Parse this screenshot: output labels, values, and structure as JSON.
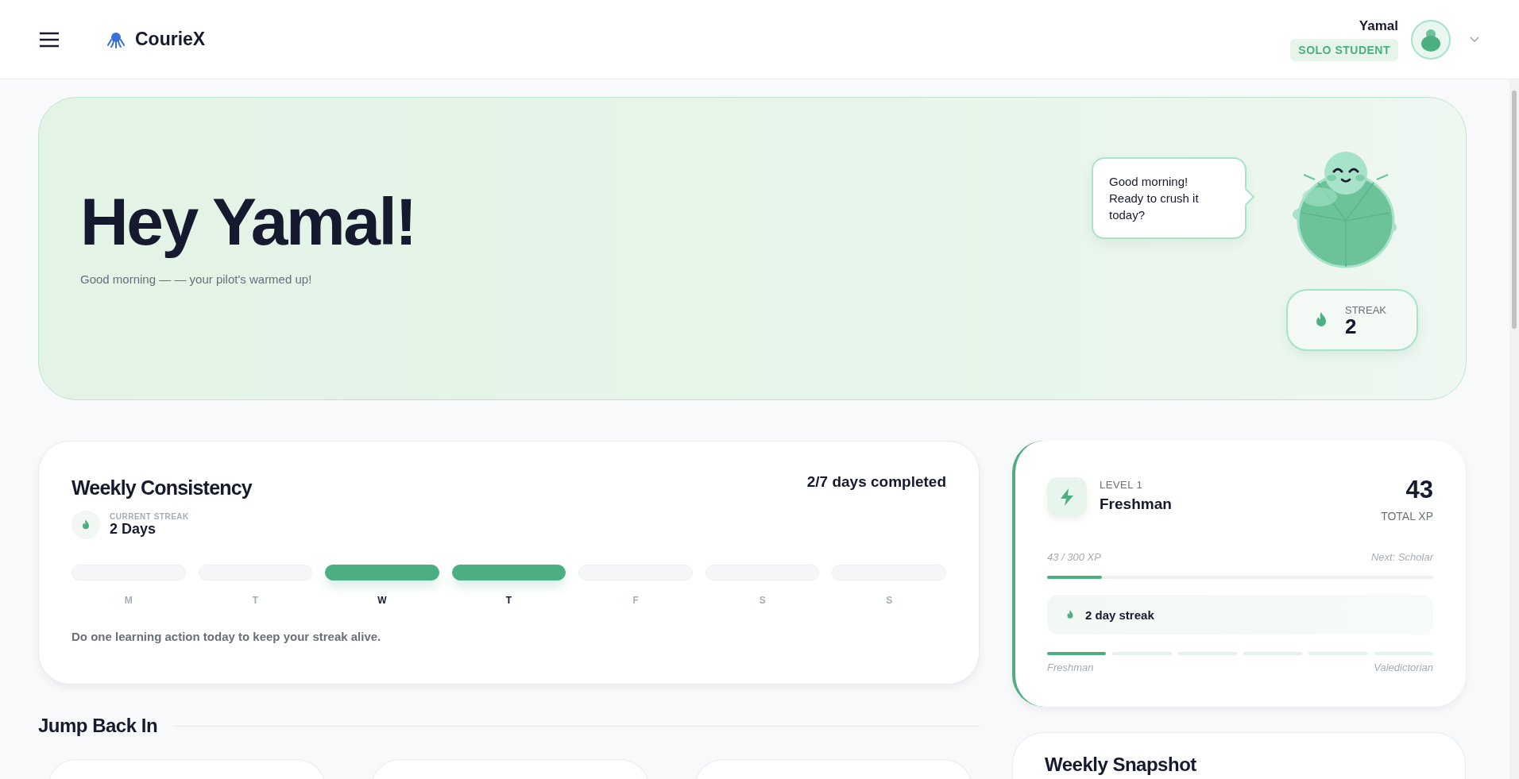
{
  "header": {
    "brand": "CourieX",
    "user": {
      "name": "Yamal",
      "role": "SOLO STUDENT"
    }
  },
  "hero": {
    "title": "Hey Yamal!",
    "subtitle": "Good morning — — your pilot's warmed up!",
    "speech": "Good morning! Ready to crush it today?",
    "streak": {
      "label": "STREAK",
      "value": "2"
    }
  },
  "weekly": {
    "title": "Weekly Consistency",
    "summary": "2/7 days completed",
    "streak_label": "CURRENT STREAK",
    "streak_value": "2 Days",
    "days": [
      {
        "label": "M",
        "completed": false
      },
      {
        "label": "T",
        "completed": false
      },
      {
        "label": "W",
        "completed": true
      },
      {
        "label": "T",
        "completed": true
      },
      {
        "label": "F",
        "completed": false
      },
      {
        "label": "S",
        "completed": false
      },
      {
        "label": "S",
        "completed": false
      }
    ],
    "hint": "Do one learning action today to keep your streak alive."
  },
  "level": {
    "level_label": "LEVEL 1",
    "rank": "Freshman",
    "xp": "43",
    "xp_label": "TOTAL XP",
    "progress_text": "43 / 300 XP",
    "next": "Next: Scholar",
    "level": 0.143,
    "streak_text": "2 day streak",
    "tiers": [
      {
        "reached": true
      },
      {
        "reached": false
      },
      {
        "reached": false
      },
      {
        "reached": false
      },
      {
        "reached": false
      },
      {
        "reached": false
      }
    ],
    "start_label": "Freshman",
    "end_label": "Valedictorian"
  },
  "jump_back_in": {
    "title": "Jump Back In"
  },
  "weekly_snapshot": {
    "title": "Weekly Snapshot"
  }
}
